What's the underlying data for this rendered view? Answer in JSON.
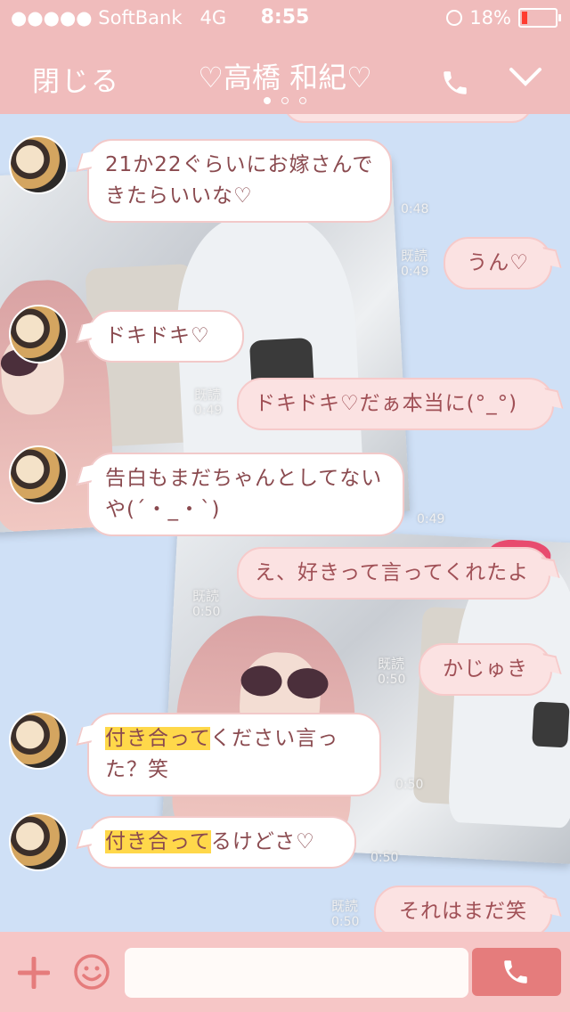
{
  "status_bar": {
    "carrier": "●●●●● SoftBank",
    "network": "4G",
    "time": "8:55",
    "battery_percent": "18%",
    "battery_level": 0.18,
    "battery_color": "#ff3b30"
  },
  "header": {
    "close_label": "閉じる",
    "title": "♡高橋 和紀♡",
    "page_dots": 3,
    "active_dot": 0,
    "phone_icon": "phone-icon",
    "chevron_icon": "chevron-down-icon"
  },
  "messages": [
    {
      "side": "left",
      "text": "21か22ぐらいにお嫁さんできたらいいな♡",
      "time": "0:48"
    },
    {
      "side": "right",
      "text": "うん♡",
      "read": "既読",
      "time": "0:49"
    },
    {
      "side": "left",
      "text": "ドキドキ♡",
      "time": ""
    },
    {
      "side": "right",
      "text": "ドキドキ♡だぁ本当に(°_°)",
      "read": "既読",
      "time": "0:49"
    },
    {
      "side": "left",
      "text": "告白もまだちゃんとしてないや(´・_・`)",
      "time": "0:49"
    },
    {
      "side": "right",
      "text": "え、好きって言ってくれたよ",
      "read": "既読",
      "time": "0:50"
    },
    {
      "side": "right",
      "text": "かじゅき",
      "read": "既読",
      "time": "0:50"
    },
    {
      "side": "left",
      "highlight": "付き合って",
      "text": "ください言った？笑",
      "time": "0:50"
    },
    {
      "side": "left",
      "highlight": "付き合って",
      "text": "るけどさ♡",
      "time": "0:50"
    },
    {
      "side": "right",
      "text": "それはまだ笑",
      "read": "既読",
      "time": "0:50"
    }
  ],
  "input_bar": {
    "plus_icon": "plus-icon",
    "emoji_icon": "smile-icon",
    "placeholder": "",
    "call_icon": "phone-icon"
  },
  "colors": {
    "header_bg": "#f0bcbc",
    "chat_bg": "#cfe0f6",
    "highlight": "#ffd84a",
    "call_button": "#e57c7c"
  }
}
